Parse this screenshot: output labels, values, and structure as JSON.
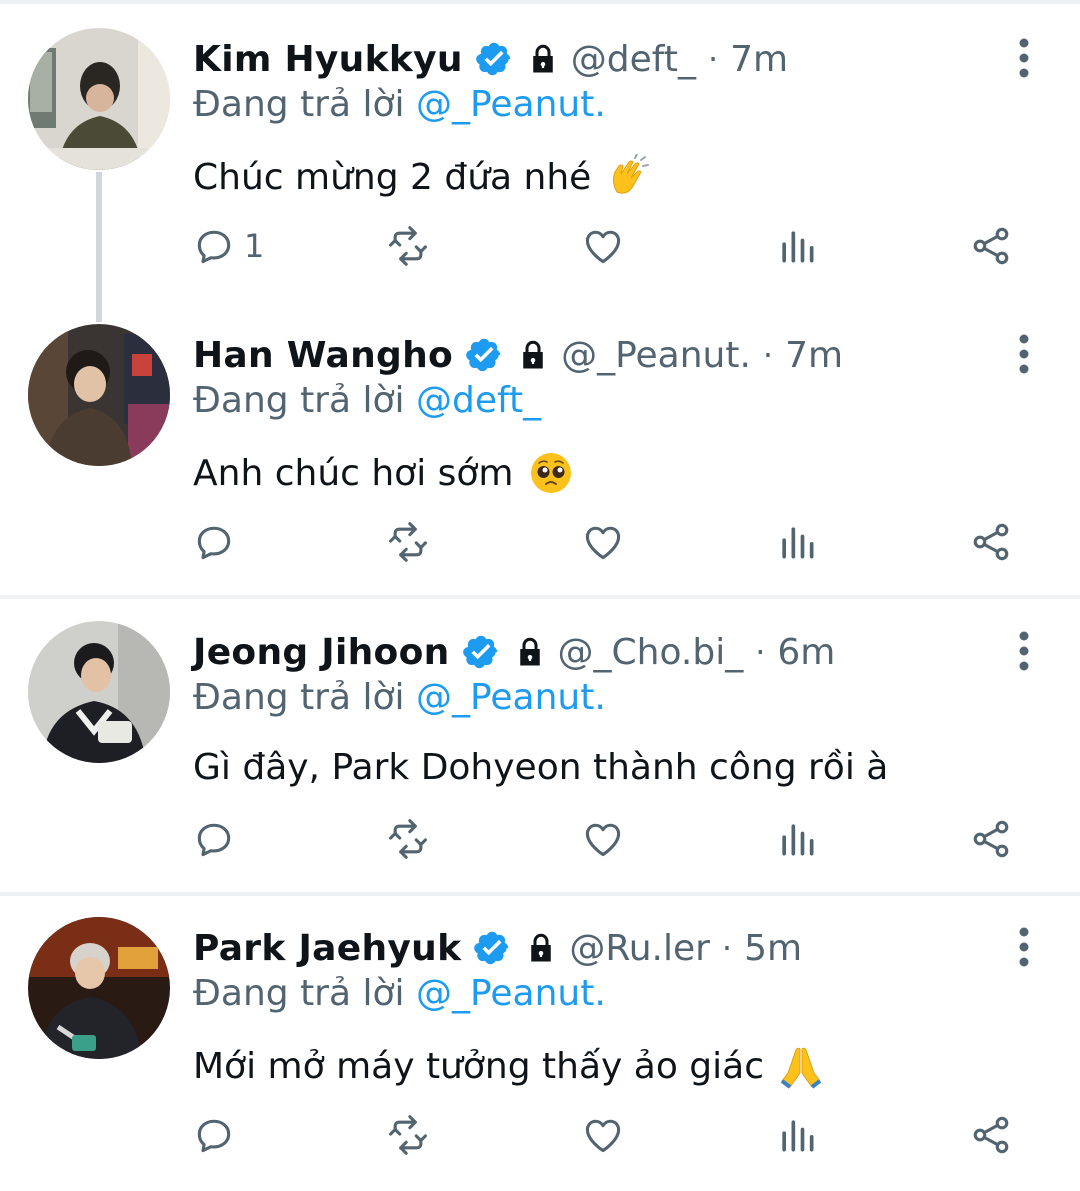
{
  "reply_prefix": "Đang trả lời",
  "tweets": [
    {
      "name": "Kim Hyukkyu",
      "handle": "@deft_",
      "dot": "·",
      "time": "7m",
      "reply_to": "@_Peanut.",
      "text": "Chúc mừng 2 đứa nhé",
      "emoji": "clapping-hands",
      "reply_count": "1"
    },
    {
      "name": "Han Wangho",
      "handle": "@_Peanut.",
      "dot": "·",
      "time": "7m",
      "reply_to": "@deft_",
      "text": "Anh chúc hơi sớm",
      "emoji": "pleading-face",
      "reply_count": ""
    },
    {
      "name": "Jeong Jihoon",
      "handle": "@_Cho.bi_",
      "dot": "·",
      "time": "6m",
      "reply_to": "@_Peanut.",
      "text": "Gì đây, Park Dohyeon thành công rồi à",
      "emoji": "",
      "reply_count": ""
    },
    {
      "name": "Park Jaehyuk",
      "handle": "@Ru.ler",
      "dot": "·",
      "time": "5m",
      "reply_to": "@_Peanut.",
      "text": "Mới mở máy tưởng thấy ảo giác",
      "emoji": "folded-hands",
      "reply_count": ""
    }
  ],
  "colors": {
    "accent": "#1d9bf0",
    "muted": "#536471",
    "text": "#0f1419",
    "separator": "#eff1f3"
  }
}
